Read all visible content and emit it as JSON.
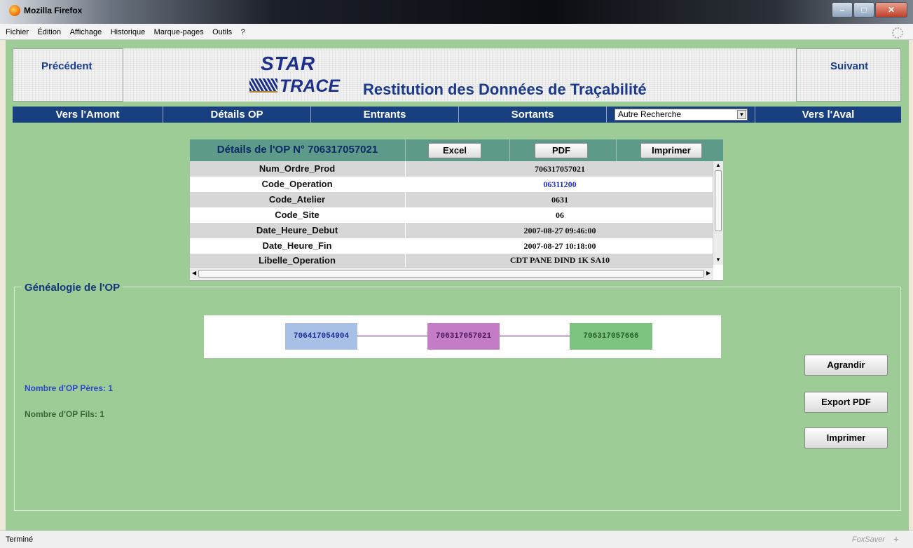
{
  "window": {
    "title": "Mozilla Firefox"
  },
  "menu": [
    "Fichier",
    "Édition",
    "Affichage",
    "Historique",
    "Marque-pages",
    "Outils",
    "?"
  ],
  "header": {
    "prev_label": "Précédent",
    "next_label": "Suivant",
    "logo_star": "STAR",
    "logo_trace": "TRACE",
    "title": "Restitution des Données de Traçabilité"
  },
  "nav": {
    "amont": "Vers l'Amont",
    "details": "Détails OP",
    "entrants": "Entrants",
    "sortants": "Sortants",
    "search_select": "Autre Recherche",
    "aval": "Vers l'Aval"
  },
  "details": {
    "title": "Détails de l'OP N° 706317057021",
    "excel": "Excel",
    "pdf": "PDF",
    "print": "Imprimer",
    "rows": [
      {
        "key": "Num_Ordre_Prod",
        "value": "706317057021"
      },
      {
        "key": "Code_Operation",
        "value": "06311200"
      },
      {
        "key": "Code_Atelier",
        "value": "0631"
      },
      {
        "key": "Code_Site",
        "value": "06"
      },
      {
        "key": "Date_Heure_Debut",
        "value": "2007-08-27 09:46:00"
      },
      {
        "key": "Date_Heure_Fin",
        "value": "2007-08-27 10:18:00"
      },
      {
        "key": "Libelle_Operation",
        "value": "CDT PANE DIND 1K SA10"
      }
    ]
  },
  "genealogy": {
    "legend": "Généalogie de l'OP",
    "parent": "706417054904",
    "current": "706317057021",
    "child": "706317057666",
    "colors": {
      "parent": "#a8c0e6",
      "current": "#c57cc7",
      "child": "#7cc47f",
      "link": "#6a1a8a"
    },
    "peres_label": "Nombre d'OP Pères: 1",
    "fils_label": "Nombre d'OP Fils: 1",
    "agrandir": "Agrandir",
    "export_pdf": "Export PDF",
    "imprimer": "Imprimer"
  },
  "status": {
    "text": "Terminé",
    "addon": "FoxSaver"
  },
  "colors": {
    "page_bg": "#9ecc97",
    "nav_bg": "#183f80",
    "details_header_bg": "#5d9a8a"
  }
}
